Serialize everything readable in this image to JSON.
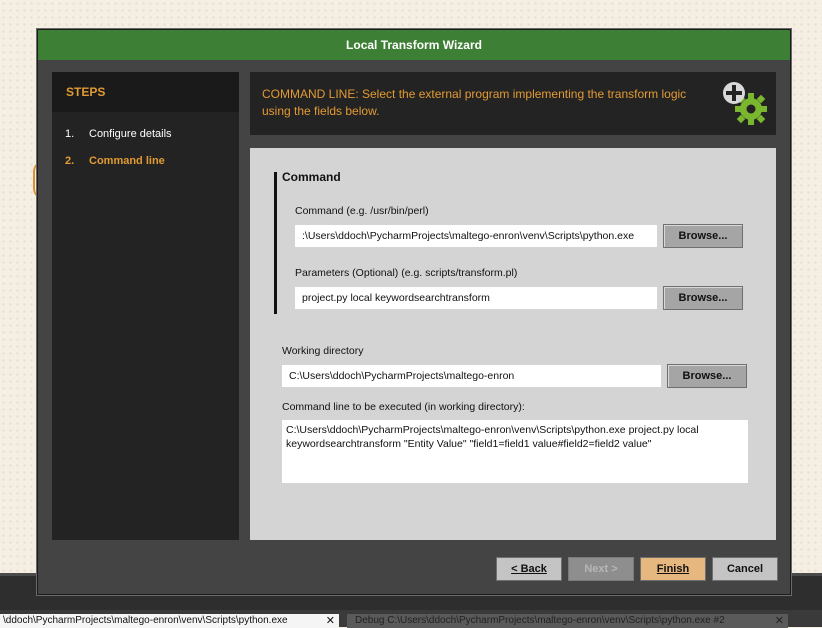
{
  "window": {
    "title": "Local Transform Wizard"
  },
  "steps": {
    "title": "STEPS",
    "items": [
      {
        "num": "1.",
        "label": "Configure details"
      },
      {
        "num": "2.",
        "label": "Command line"
      }
    ]
  },
  "header": {
    "text": "COMMAND LINE: Select the external program implementing the transform logic using the fields below.",
    "icon": "add-gear-icon"
  },
  "command_section": {
    "title": "Command",
    "command_label": "Command (e.g. /usr/bin/perl)",
    "command_value": ":\\Users\\ddoch\\PycharmProjects\\maltego-enron\\venv\\Scripts\\python.exe",
    "parameters_label": "Parameters (Optional) (e.g. scripts/transform.pl)",
    "parameters_value": "project.py local keywordsearchtransform",
    "browse_label": "Browse..."
  },
  "working_dir": {
    "label": "Working directory",
    "value": "C:\\Users\\ddoch\\PycharmProjects\\maltego-enron"
  },
  "command_line": {
    "label": "Command line to be executed (in working directory):",
    "value": "C:\\Users\\ddoch\\PycharmProjects\\maltego-enron\\venv\\Scripts\\python.exe project.py local keywordsearchtransform \"Entity Value\" \"field1=field1 value#field2=field2 value\""
  },
  "footer": {
    "back": "< Back",
    "next": "Next >",
    "finish": "Finish",
    "cancel": "Cancel"
  },
  "background": {
    "tab1": "\\ddoch\\PycharmProjects\\maltego-enron\\venv\\Scripts\\python.exe",
    "tab2": "Debug C:\\Users\\ddoch\\PycharmProjects\\maltego-enron\\venv\\Scripts\\python.exe #2",
    "close_glyph": "✕"
  },
  "colors": {
    "accent": "#e29a33",
    "title_bar": "#3d7f34",
    "icon_green": "#7ab72e"
  }
}
